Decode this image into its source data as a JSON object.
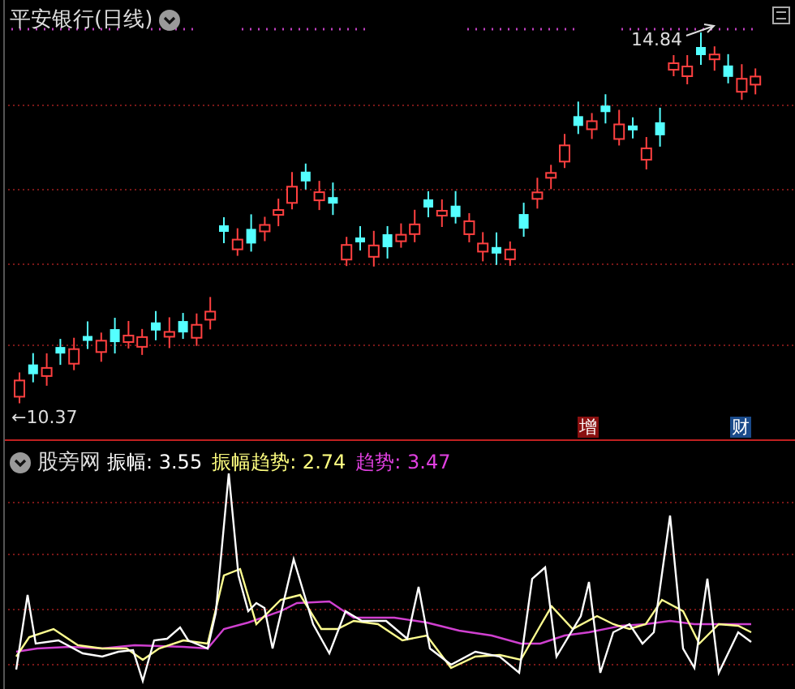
{
  "main_chart": {
    "title": "平安银行(日线)",
    "high_label": "14.84",
    "low_label": "←10.37",
    "event_markers": [
      {
        "label": "增",
        "kind": "increase"
      },
      {
        "label": "财",
        "kind": "finance"
      }
    ]
  },
  "indicator": {
    "name": "股旁网",
    "readings": [
      {
        "label": "振幅:",
        "value": "3.55",
        "color": "#ffffff"
      },
      {
        "label": "振幅趋势:",
        "value": "2.74",
        "color": "#ffff80"
      },
      {
        "label": "趋势:",
        "value": "3.47",
        "color": "#e040e0"
      }
    ]
  }
}
